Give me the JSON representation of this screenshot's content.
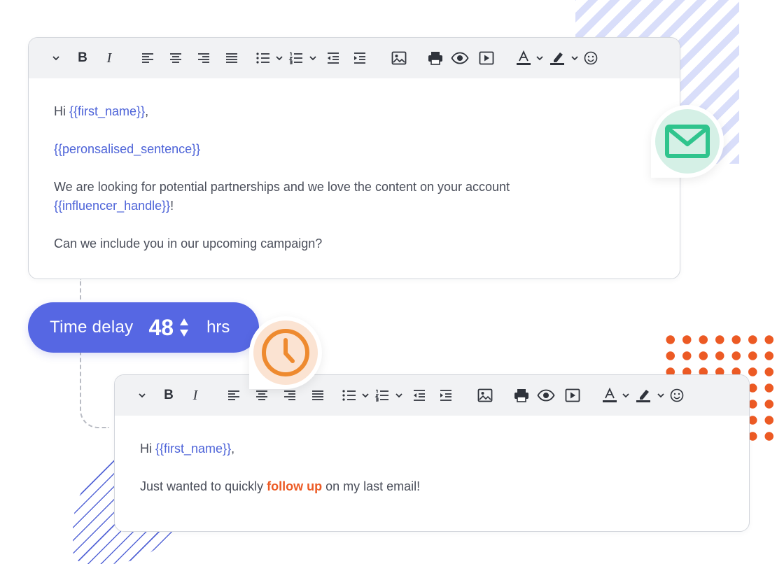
{
  "editors": [
    {
      "greeting_prefix": "Hi ",
      "greeting_var": "{{first_name}}",
      "greeting_suffix": ",",
      "line2_var": "{{peronsalised_sentence}}",
      "line3_text": "We are looking for potential partnerships and we love the content on your account ",
      "line3_var": "{{influencer_handle}}",
      "line3_suffix": "!",
      "line4_text": "Can we include you in our upcoming campaign?"
    },
    {
      "greeting_prefix": "Hi ",
      "greeting_var": "{{first_name}}",
      "greeting_suffix": ",",
      "line2_before": "Just wanted to quickly ",
      "line2_highlight": "follow up",
      "line2_after": " on my last email!"
    }
  ],
  "toolbar": {
    "bold": "B",
    "italic": "I",
    "icons": [
      "chevron-down-icon",
      "bold-icon",
      "italic-icon",
      "align-left-icon",
      "align-center-icon",
      "align-right-icon",
      "align-justify-icon",
      "bullet-list-icon",
      "numbered-list-icon",
      "outdent-icon",
      "indent-icon",
      "image-icon",
      "print-icon",
      "preview-icon",
      "media-icon",
      "text-color-icon",
      "highlight-icon",
      "emoji-icon"
    ]
  },
  "time_delay": {
    "label": "Time delay",
    "value": "48",
    "unit": "hrs"
  },
  "colors": {
    "accent": "#5667e3",
    "variable": "#4d63d8",
    "highlight": "#ec5a24",
    "mail_green": "#2fc48d",
    "clock_orange": "#ee8a2f"
  }
}
